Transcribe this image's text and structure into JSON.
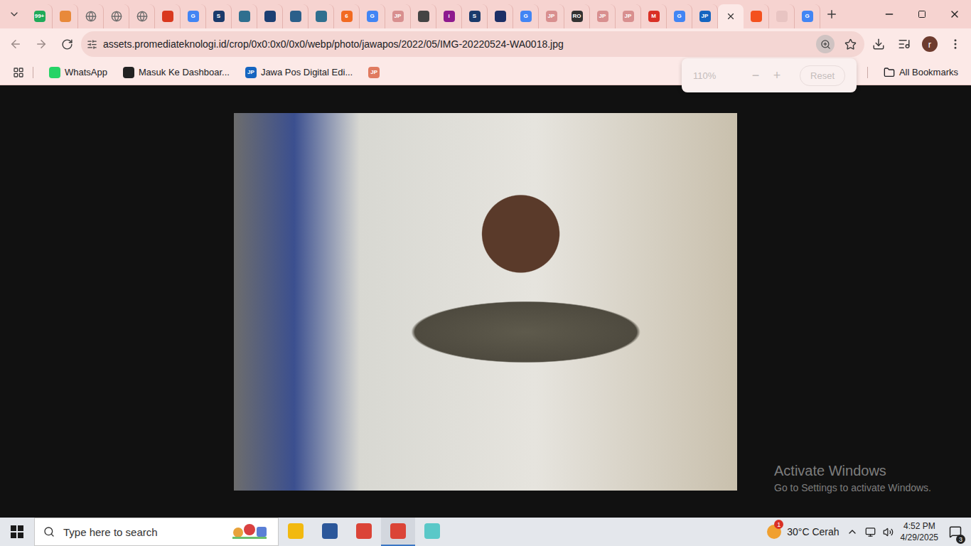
{
  "browser": {
    "tabs": [
      {
        "kind": "favicon",
        "color": "#1faa59",
        "glyph": "99+",
        "selected": false
      },
      {
        "kind": "favicon",
        "color": "#e8893a",
        "glyph": "",
        "selected": false
      },
      {
        "kind": "globe",
        "color": "#6b6b6b",
        "glyph": "",
        "selected": false
      },
      {
        "kind": "globe",
        "color": "#6b6b6b",
        "glyph": "",
        "selected": false
      },
      {
        "kind": "globe",
        "color": "#6b6b6b",
        "glyph": "",
        "selected": false
      },
      {
        "kind": "favicon",
        "color": "#d9381e",
        "glyph": "",
        "selected": false
      },
      {
        "kind": "favicon",
        "color": "#4285f4",
        "glyph": "G",
        "selected": false
      },
      {
        "kind": "favicon",
        "color": "#1a3a6b",
        "glyph": "S",
        "selected": false
      },
      {
        "kind": "favicon",
        "color": "#2f6f8f",
        "glyph": "",
        "selected": false
      },
      {
        "kind": "favicon",
        "color": "#1c3f73",
        "glyph": "",
        "selected": false
      },
      {
        "kind": "favicon",
        "color": "#2b5f8a",
        "glyph": "",
        "selected": false
      },
      {
        "kind": "favicon",
        "color": "#2f6f8f",
        "glyph": "",
        "selected": false
      },
      {
        "kind": "favicon",
        "color": "#f26a21",
        "glyph": "6",
        "selected": false
      },
      {
        "kind": "favicon",
        "color": "#4285f4",
        "glyph": "G",
        "selected": false
      },
      {
        "kind": "favicon",
        "color": "#d88f8f",
        "glyph": "JP",
        "selected": false
      },
      {
        "kind": "favicon",
        "color": "#444444",
        "glyph": "",
        "selected": false
      },
      {
        "kind": "favicon",
        "color": "#8e1a8e",
        "glyph": "i",
        "selected": false
      },
      {
        "kind": "favicon",
        "color": "#1a3a6b",
        "glyph": "S",
        "selected": false
      },
      {
        "kind": "favicon",
        "color": "#1c2f66",
        "glyph": "",
        "selected": false
      },
      {
        "kind": "favicon",
        "color": "#4285f4",
        "glyph": "G",
        "selected": false
      },
      {
        "kind": "favicon",
        "color": "#d88f8f",
        "glyph": "JP",
        "selected": false
      },
      {
        "kind": "favicon",
        "color": "#333333",
        "glyph": "RO",
        "selected": false
      },
      {
        "kind": "favicon",
        "color": "#d88f8f",
        "glyph": "JP",
        "selected": false
      },
      {
        "kind": "favicon",
        "color": "#d88f8f",
        "glyph": "JP",
        "selected": false
      },
      {
        "kind": "favicon",
        "color": "#d93025",
        "glyph": "M",
        "selected": false
      },
      {
        "kind": "favicon",
        "color": "#4285f4",
        "glyph": "G",
        "selected": false
      },
      {
        "kind": "favicon",
        "color": "#1565c0",
        "glyph": "JP",
        "selected": false
      },
      {
        "kind": "close",
        "color": "#333333",
        "glyph": "",
        "selected": true
      },
      {
        "kind": "favicon",
        "color": "#f4511e",
        "glyph": "",
        "selected": false
      },
      {
        "kind": "favicon",
        "color": "#e8c4c2",
        "glyph": "",
        "selected": false
      },
      {
        "kind": "favicon",
        "color": "#4285f4",
        "glyph": "G",
        "selected": false
      }
    ],
    "address": "assets.promediateknologi.id/crop/0x0:0x0/0x0/webp/photo/jawapos/2022/05/IMG-20220524-WA0018.jpg",
    "profile_initial": "r",
    "bookmarks": [
      {
        "label": "WhatsApp",
        "color": "#25d366",
        "glyph": ""
      },
      {
        "label": "Masuk Ke Dashboar...",
        "color": "#222222",
        "glyph": ""
      },
      {
        "label": "Jawa Pos Digital Edi...",
        "color": "#1565c0",
        "glyph": "JP"
      },
      {
        "label": "",
        "color": "#e07a5f",
        "glyph": "JP"
      }
    ],
    "all_bookmarks": "All Bookmarks",
    "zoom_popup": {
      "level": "110%",
      "minus": "−",
      "plus": "+",
      "reset": "Reset"
    }
  },
  "watermark": {
    "title": "Activate Windows",
    "subtitle": "Go to Settings to activate Windows."
  },
  "taskbar": {
    "search_placeholder": "Type here to search",
    "apps": [
      {
        "name": "file-explorer",
        "color": "#f2b90f",
        "selected": false
      },
      {
        "name": "word",
        "color": "#2b579a",
        "selected": false
      },
      {
        "name": "chrome",
        "color": "#db4437",
        "selected": false
      },
      {
        "name": "chrome-profile",
        "color": "#db4437",
        "selected": true
      },
      {
        "name": "app",
        "color": "#5ac8c8",
        "selected": false
      }
    ],
    "weather": {
      "reading": "30°C Cerah",
      "badge": "1"
    },
    "time": "4:52 PM",
    "date": "4/29/2025",
    "notifications": "3"
  }
}
